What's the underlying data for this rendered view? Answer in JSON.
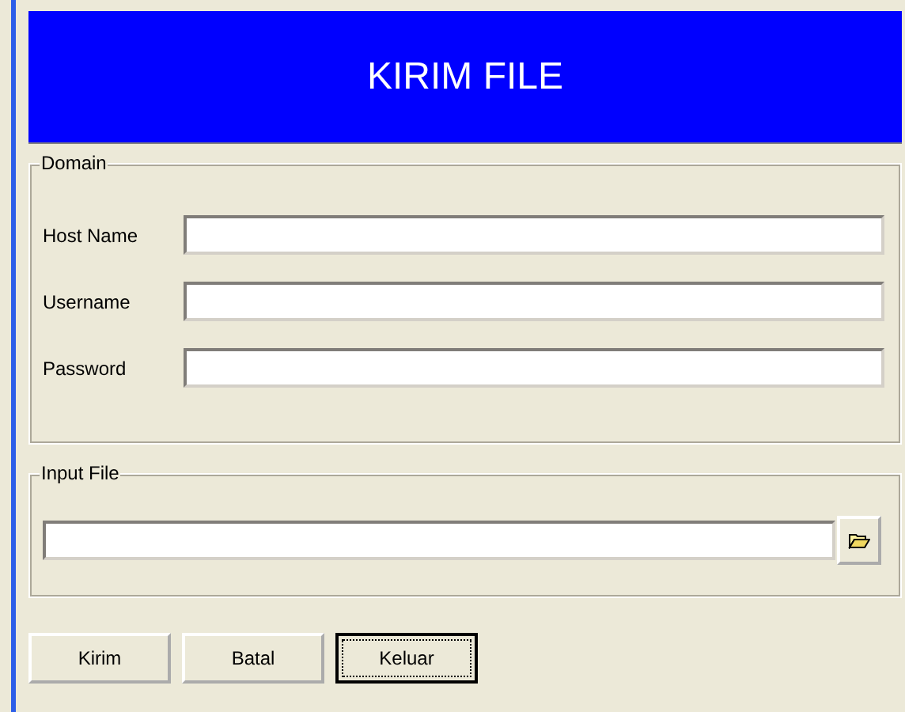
{
  "header": {
    "title": "KIRIM FILE"
  },
  "domain": {
    "legend": "Domain",
    "fields": [
      {
        "label": "Host Name"
      },
      {
        "label": "Username"
      },
      {
        "label": "Password"
      }
    ]
  },
  "input_file": {
    "legend": "Input File"
  },
  "buttons": [
    {
      "label": "Kirim",
      "focused": false
    },
    {
      "label": "Batal",
      "focused": false
    },
    {
      "label": "Keluar",
      "focused": true
    }
  ]
}
